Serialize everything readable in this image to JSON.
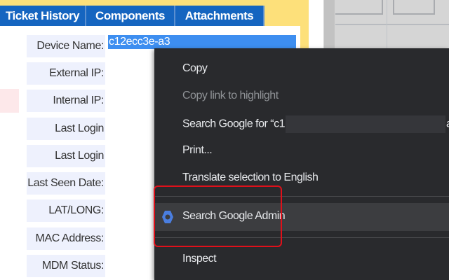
{
  "tabs": [
    "Ticket History",
    "Components",
    "Attachments"
  ],
  "fields": [
    {
      "label": "Device Name:",
      "value": "c12ecc3e-a3"
    },
    {
      "label": "External IP:"
    },
    {
      "label": "Internal IP:"
    },
    {
      "label": "Last Login Date:"
    },
    {
      "label": "Last Login User:"
    },
    {
      "label": "Last Seen Date:"
    },
    {
      "label": "LAT/LONG:"
    },
    {
      "label": "MAC Address:"
    },
    {
      "label": "MDM Status:"
    }
  ],
  "context_menu": {
    "copy": "Copy",
    "copy_link": "Copy link to highlight",
    "search_prefix": "Search Google for “c1",
    "search_suffix": "a”",
    "print": "Print...",
    "translate": "Translate selection to English",
    "search_admin": "Search Google Admin",
    "inspect": "Inspect"
  },
  "colors": {
    "tab": "#1565c0",
    "menu": "#292a2d",
    "highlight": "#e0101a",
    "selection": "#3d8ef0"
  }
}
